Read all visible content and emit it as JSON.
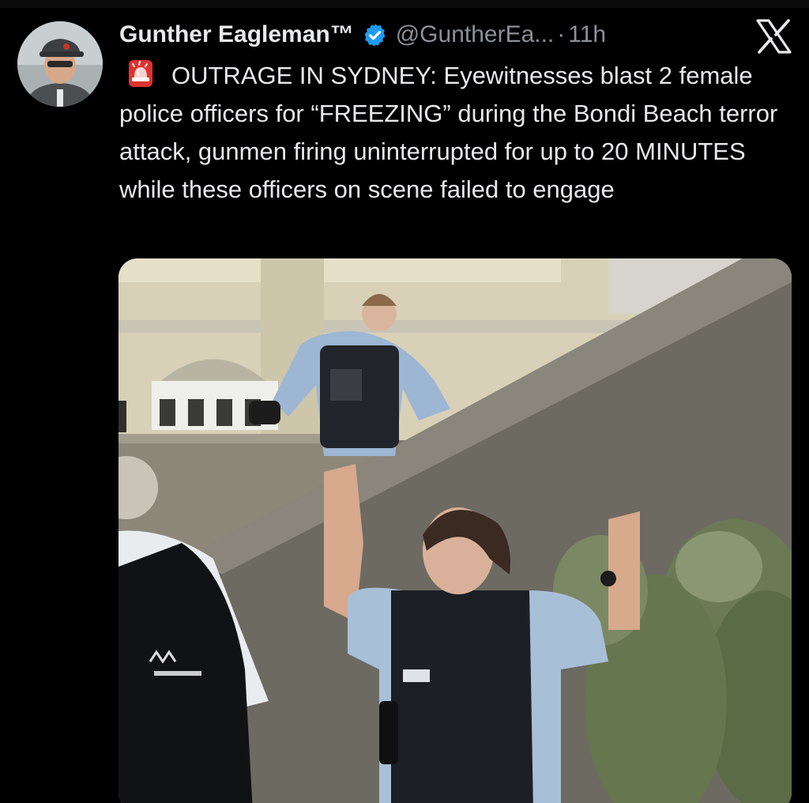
{
  "tweet": {
    "author": {
      "display_name": "Gunther Eagleman™",
      "handle": "@GuntherEa...",
      "separator": "·",
      "time": "11h",
      "verified": true,
      "avatar_icon": "profile-avatar"
    },
    "body": {
      "emoji_icon": "police-siren-icon",
      "text": "OUTRAGE IN SYDNEY: Eyewitnesses blast 2 female police officers for “FREEZING” during the Bondi Beach terror attack,  gunmen firing uninterrupted for up to 20 MINUTES while these officers on scene failed to engage"
    },
    "media": {
      "type": "photo",
      "description_icon": "attached-photo"
    },
    "brand_icon": "x-logo-icon"
  },
  "colors": {
    "background": "#000000",
    "text_primary": "#e7e9ea",
    "text_secondary": "#8b9196",
    "verified_blue": "#1d9bf0",
    "siren_red": "#e0322f"
  }
}
